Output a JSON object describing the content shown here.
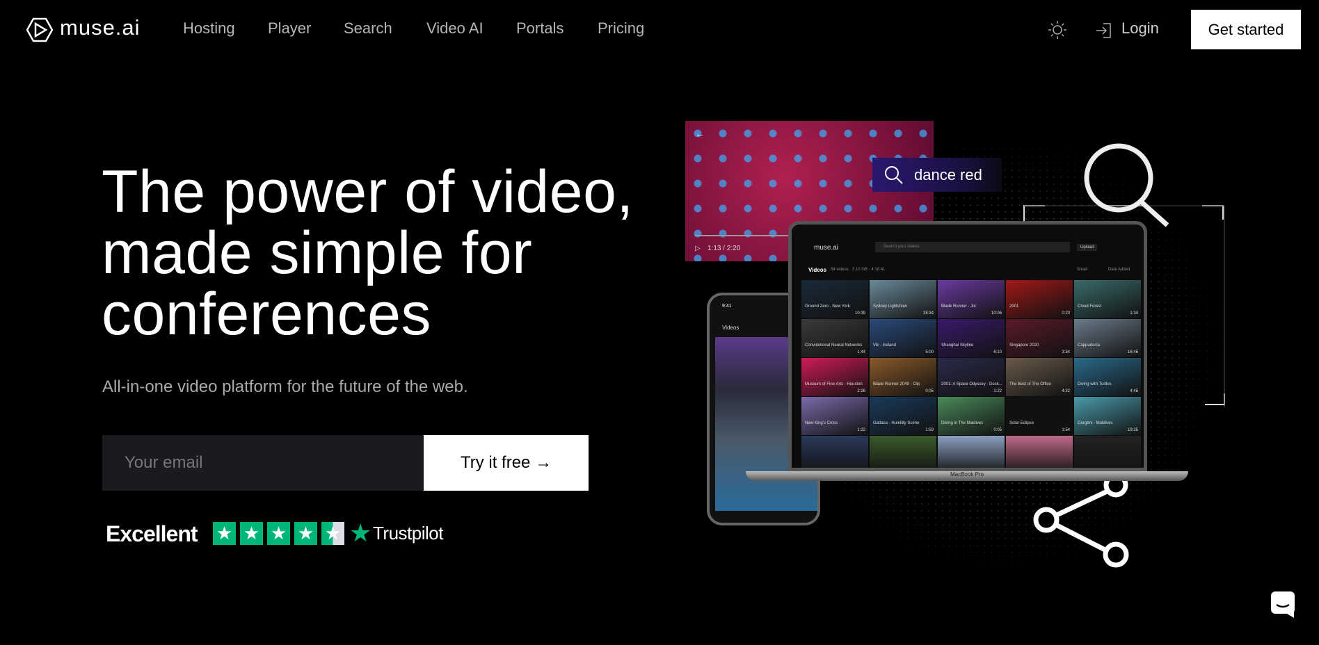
{
  "nav": {
    "brand": "muse.ai",
    "items": [
      "Hosting",
      "Player",
      "Search",
      "Video AI",
      "Portals",
      "Pricing"
    ],
    "login": "Login",
    "get_started": "Get started"
  },
  "hero": {
    "title_lines": [
      "The power of video,",
      "made simple for",
      "conferences"
    ],
    "subtitle": "All-in-one video platform for the future of the web.",
    "email_placeholder": "Your email",
    "cta": "Try it free",
    "arrow": "→"
  },
  "trust": {
    "label": "Excellent",
    "rating_stars": 4.5,
    "brand": "Trustpilot",
    "color": "#00b67a"
  },
  "illustration": {
    "search_query": "dance red",
    "player_time": "1:13 / 2:20",
    "laptop_label": "MacBook Pro",
    "app_search_placeholder": "Search your videos",
    "upload": "Upload",
    "videos_heading": "Videos",
    "videos_meta": "54 videos · 3.10 GB · 4:18:41",
    "sort_small": "Small",
    "sort_date": "Date Added",
    "phone_heading": "Videos",
    "videos": [
      {
        "t": "Ground Zero - New York",
        "d": "10:39",
        "c": "#1a2a3a"
      },
      {
        "t": "Sydney Lightshow",
        "d": "35:34",
        "c": "#6a8a9a"
      },
      {
        "t": "Blade Runner - Joi",
        "d": "10:06",
        "c": "#6a3aa0"
      },
      {
        "t": "2001",
        "d": "0:20",
        "c": "#a01818"
      },
      {
        "t": "Cloud Forest",
        "d": "1:34",
        "c": "#3a6a6a"
      },
      {
        "t": "Convolutional Neural Networks",
        "d": "1:44",
        "c": "#3a3a3a"
      },
      {
        "t": "Vik - Iceland",
        "d": "5:00",
        "c": "#2a4a7a"
      },
      {
        "t": "Shanghai Skyline",
        "d": "6:10",
        "c": "#3a1a6a"
      },
      {
        "t": "Singapore 2020",
        "d": "3:34",
        "c": "#5a1a2a"
      },
      {
        "t": "Cappadocia",
        "d": "16:45",
        "c": "#6a7a8a"
      },
      {
        "t": "Museum of Fine Arts - Houston",
        "d": "2:26",
        "c": "#d01a5a"
      },
      {
        "t": "Blade Runner 2049 - Clip",
        "d": "0:05",
        "c": "#8a5a2a"
      },
      {
        "t": "2001: A Space Odyssey - Dock...",
        "d": "1:22",
        "c": "#2a2a4a"
      },
      {
        "t": "The Best of The Office",
        "d": "4:32",
        "c": "#6a5a4a"
      },
      {
        "t": "Diving with Turtles",
        "d": "4:45",
        "c": "#2a6a8a"
      },
      {
        "t": "New King's Cross",
        "d": "1:22",
        "c": "#7a6aaa"
      },
      {
        "t": "Gattaca - Humility Scene",
        "d": "1:59",
        "c": "#1a3a5a"
      },
      {
        "t": "Diving in The Maldives",
        "d": "0:05",
        "c": "#4a8a5a"
      },
      {
        "t": "Solar Eclipse",
        "d": "1:54",
        "c": "#111"
      },
      {
        "t": "Gurgeni - Maldives",
        "d": "19:25",
        "c": "#4a9aaa"
      }
    ]
  }
}
